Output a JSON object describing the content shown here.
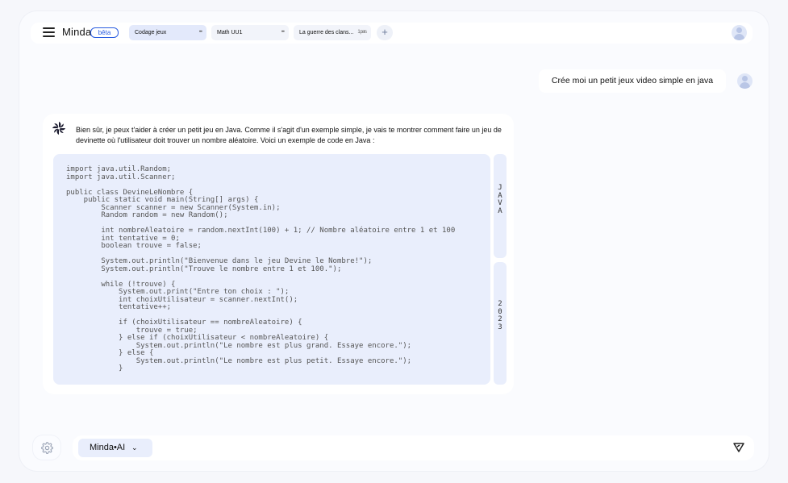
{
  "header": {
    "brand": "Minda",
    "badge": "bêta",
    "tabs": [
      {
        "label": "Codage jeux",
        "more": "•••"
      },
      {
        "label": "Math UU1",
        "more": "•••"
      },
      {
        "label": "La guerre des clans...",
        "more": "1 pers"
      }
    ],
    "add_tab": "+"
  },
  "conversation": {
    "user_message": "Crée moi un petit jeux video simple en java",
    "ai_message": "Bien sûr, je peux t'aider à créer un petit jeu en Java. Comme il s'agit d'un exemple simple, je vais te montrer comment faire un jeu de devinette où l'utilisateur doit trouver un nombre aléatoire. Voici un exemple de code en Java :",
    "code": "import java.util.Random;\nimport java.util.Scanner;\n\npublic class DevineLeNombre {\n    public static void main(String[] args) {\n        Scanner scanner = new Scanner(System.in);\n        Random random = new Random();\n\n        int nombreAleatoire = random.nextInt(100) + 1; // Nombre aléatoire entre 1 et 100\n        int tentative = 0;\n        boolean trouve = false;\n\n        System.out.println(\"Bienvenue dans le jeu Devine le Nombre!\");\n        System.out.println(\"Trouve le nombre entre 1 et 100.\");\n\n        while (!trouve) {\n            System.out.print(\"Entre ton choix : \");\n            int choixUtilisateur = scanner.nextInt();\n            tentative++;\n\n            if (choixUtilisateur == nombreAleatoire) {\n                trouve = true;\n            } else if (choixUtilisateur < nombreAleatoire) {\n                System.out.println(\"Le nombre est plus grand. Essaye encore.\");\n            } else {\n                System.out.println(\"Le nombre est plus petit. Essaye encore.\");\n            }",
    "code_language": "J\nA\nV\nA",
    "code_year": "2\n0\n2\n3"
  },
  "footer": {
    "model": "Minda•AI",
    "model_chevron": "⌄"
  },
  "icons": {
    "menu": "hamburger-icon",
    "avatar": "user-avatar-icon",
    "ai": "pinwheel-icon",
    "settings": "gear-icon",
    "send": "send-icon",
    "dropdown": "chevron-down-icon"
  },
  "colors": {
    "accent": "#2b5de0",
    "code_bg": "#e9eefc",
    "active_tab": "#e3e9fb"
  }
}
